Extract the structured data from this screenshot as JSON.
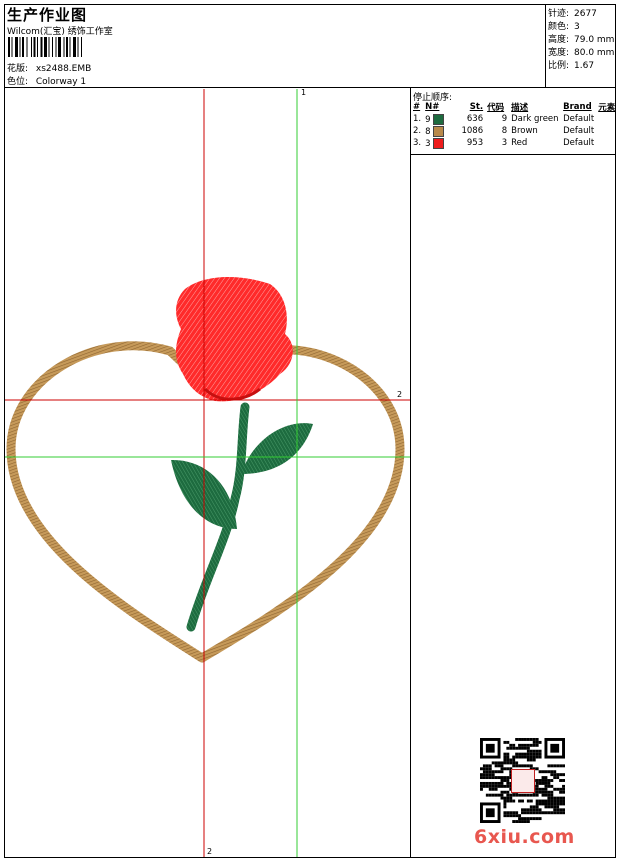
{
  "header": {
    "title": "生产作业图",
    "subtitle": "Wilcom(汇宝) 绣饰工作室",
    "design_label": "花版:",
    "design_value": "xs2488.EMB",
    "colorway_label": "色位:",
    "colorway_value": "Colorway 1"
  },
  "specs": [
    {
      "label": "针迹:",
      "value": "2677"
    },
    {
      "label": "颜色:",
      "value": "3"
    },
    {
      "label": "高度:",
      "value": "79.0 mm"
    },
    {
      "label": "宽度:",
      "value": "80.0 mm"
    },
    {
      "label": "比例:",
      "value": "1.67"
    }
  ],
  "stop_sequence": {
    "title": "停止顺序:",
    "columns": [
      "#",
      "N#",
      "St.",
      "代码",
      "描述",
      "Brand",
      "元素"
    ],
    "rows": [
      {
        "idx": "1.",
        "n": "9",
        "color": "#1d6b3f",
        "st": "636",
        "code": "9",
        "desc": "Dark green",
        "brand": "Default",
        "elem": ""
      },
      {
        "idx": "2.",
        "n": "8",
        "color": "#b8894a",
        "st": "1086",
        "code": "8",
        "desc": "Brown",
        "brand": "Default",
        "elem": ""
      },
      {
        "idx": "3.",
        "n": "3",
        "color": "#ee1c1c",
        "st": "953",
        "code": "3",
        "desc": "Red",
        "brand": "Default",
        "elem": ""
      }
    ]
  },
  "guides": {
    "green_v_label": "1",
    "red_h_label": "2",
    "red_v_label": "2"
  },
  "colors": {
    "heart": "#b8894a",
    "rose": "#ee1c1c",
    "leaf": "#1d6b3f",
    "guide_red": "#cc0000",
    "guide_green": "#33cc33"
  },
  "watermark": "6xiu.com"
}
